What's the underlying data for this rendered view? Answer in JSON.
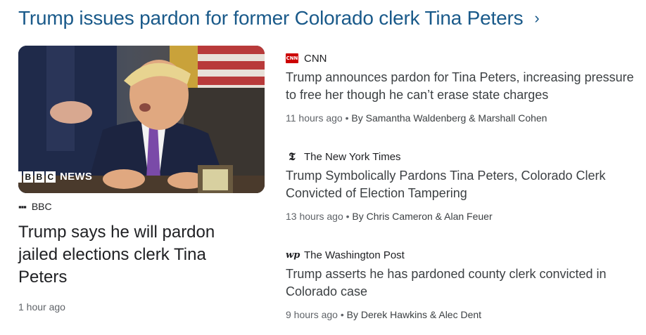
{
  "cluster": {
    "title": "Trump issues pardon for former Colorado clerk Tina Peters",
    "chevron_icon": "chevron-right-icon"
  },
  "featured": {
    "image_logo": "NEWS",
    "image_logo_blocks": [
      "",
      "B",
      "B",
      "C"
    ],
    "source_icon": "more-dots-icon",
    "source": "BBC",
    "title": "Trump says he will pardon jailed elections clerk Tina Peters",
    "time": "1 hour ago"
  },
  "stories": [
    {
      "source_icon": "cnn-logo-icon",
      "source_icon_text": "CNN",
      "source": "CNN",
      "title": "Trump announces pardon for Tina Peters, increasing pressure to free her though he can’t erase state charges",
      "time": "11 hours ago",
      "authors": "By Samantha Waldenberg & Marshall Cohen"
    },
    {
      "source_icon": "nyt-logo-icon",
      "source_icon_text": "𝕿",
      "source": "The New York Times",
      "title": "Trump Symbolically Pardons Tina Peters, Colorado Clerk Convicted of Election Tampering",
      "time": "13 hours ago",
      "authors": "By Chris Cameron & Alan Feuer"
    },
    {
      "source_icon": "wp-logo-icon",
      "source_icon_text": "wp",
      "source": "The Washington Post",
      "title": "Trump asserts he has pardoned county clerk convicted in Colorado case",
      "time": "9 hours ago",
      "authors": "By Derek Hawkins & Alec Dent"
    }
  ],
  "separator": " • ",
  "colors": {
    "headline": "#1a5a8a",
    "cnn_red": "#cc0000",
    "meta_gray": "#5f6368"
  }
}
